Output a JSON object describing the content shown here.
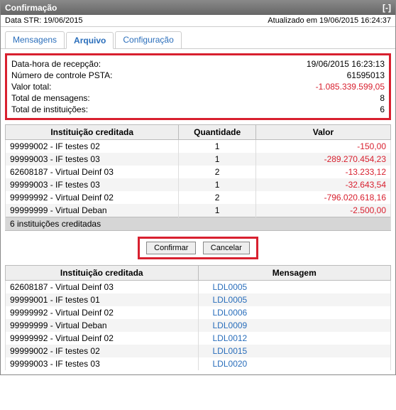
{
  "titlebar": {
    "title": "Confirmação",
    "close": "[-]"
  },
  "status": {
    "left": "Data STR: 19/06/2015",
    "right": "Atualizado em 19/06/2015 16:24:37"
  },
  "tabs": {
    "t0": "Mensagens",
    "t1": "Arquivo",
    "t2": "Configuração"
  },
  "summary": {
    "l0": "Data-hora de recepção:",
    "v0": "19/06/2015 16:23:13",
    "l1": "Número de controle PSTA:",
    "v1": "61595013",
    "l2": "Valor total:",
    "v2": "-1.085.339.599,05",
    "l3": "Total de mensagens:",
    "v3": "8",
    "l4": "Total de instituições:",
    "v4": "6"
  },
  "table1": {
    "h0": "Instituição creditada",
    "h1": "Quantidade",
    "h2": "Valor",
    "rows": [
      {
        "inst": "99999002 - IF testes 02",
        "qty": "1",
        "val": "-150,00"
      },
      {
        "inst": "99999003 - IF testes 03",
        "qty": "1",
        "val": "-289.270.454,23"
      },
      {
        "inst": "62608187 - Virtual Deinf 03",
        "qty": "2",
        "val": "-13.233,12"
      },
      {
        "inst": "99999003 - IF testes 03",
        "qty": "1",
        "val": "-32.643,54"
      },
      {
        "inst": "99999992 - Virtual Deinf 02",
        "qty": "2",
        "val": "-796.020.618,16"
      },
      {
        "inst": "99999999 - Virtual Deban",
        "qty": "1",
        "val": "-2.500,00"
      }
    ],
    "footer": "6 instituições creditadas"
  },
  "buttons": {
    "confirm": "Confirmar",
    "cancel": "Cancelar"
  },
  "table2": {
    "h0": "Instituição creditada",
    "h1": "Mensagem",
    "rows": [
      {
        "inst": "62608187 - Virtual Deinf 03",
        "msg": "LDL0005"
      },
      {
        "inst": "99999001 - IF testes 01",
        "msg": "LDL0005"
      },
      {
        "inst": "99999992 - Virtual Deinf 02",
        "msg": "LDL0006"
      },
      {
        "inst": "99999999 - Virtual Deban",
        "msg": "LDL0009"
      },
      {
        "inst": "99999992 - Virtual Deinf 02",
        "msg": "LDL0012"
      },
      {
        "inst": "99999002 - IF testes 02",
        "msg": "LDL0015"
      },
      {
        "inst": "99999003 - IF testes 03",
        "msg": "LDL0020"
      }
    ]
  },
  "chart_data": {
    "type": "table",
    "title": "Instituições creditadas — quantidade e valor",
    "columns": [
      "Instituição creditada",
      "Quantidade",
      "Valor"
    ],
    "rows": [
      [
        "99999002 - IF testes 02",
        1,
        -150.0
      ],
      [
        "99999003 - IF testes 03",
        1,
        -289270454.23
      ],
      [
        "62608187 - Virtual Deinf 03",
        2,
        -13233.12
      ],
      [
        "99999003 - IF testes 03",
        1,
        -32643.54
      ],
      [
        "99999992 - Virtual Deinf 02",
        2,
        -796020618.16
      ],
      [
        "99999999 - Virtual Deban",
        1,
        -2500.0
      ]
    ],
    "totals": {
      "mensagens": 8,
      "instituicoes": 6,
      "valor_total": -1085339599.05
    }
  }
}
